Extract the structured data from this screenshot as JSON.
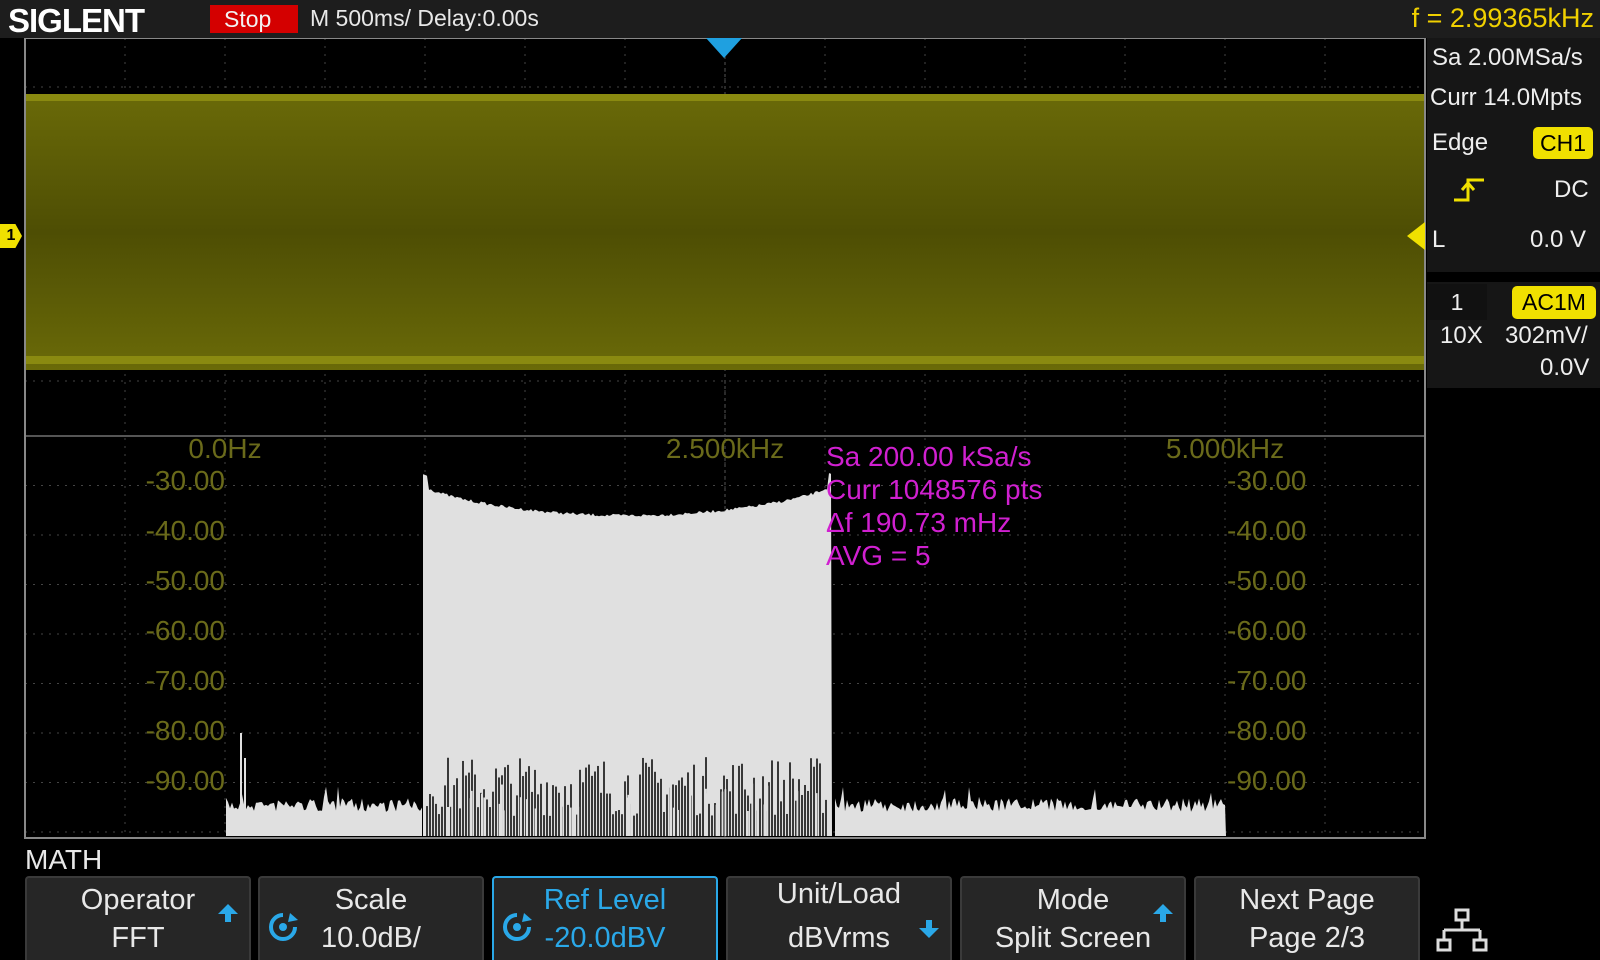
{
  "header": {
    "brand": "SIGLENT",
    "run_state": "Stop",
    "timebase": "M 500ms/  Delay:0.00s",
    "frequency": "f = 2.99365kHz"
  },
  "acquisition": {
    "sample_rate": "Sa 2.00MSa/s",
    "memory_depth": "Curr 14.0Mpts"
  },
  "trigger": {
    "type": "Edge",
    "source": "CH1",
    "coupling": "DC",
    "level_label": "L",
    "level": "0.0 V"
  },
  "channel": {
    "number": "1",
    "coupling": "AC1M",
    "probe": "10X",
    "scale": "302mV/",
    "offset": "0.0V",
    "marker": "1"
  },
  "fft": {
    "freq_labels": [
      "0.0Hz",
      "2.500kHz",
      "5.000kHz"
    ],
    "db_labels": [
      "-30.00",
      "-40.00",
      "-50.00",
      "-60.00",
      "-70.00",
      "-80.00",
      "-90.00"
    ],
    "sample_rate": "Sa 200.00 kSa/s",
    "points": "Curr 1048576 pts",
    "resolution": "Δf 190.73 mHz",
    "average": "AVG = 5"
  },
  "menu_title": "MATH",
  "softkeys": [
    {
      "line1": "Operator",
      "line2": "FFT",
      "arrow": "up"
    },
    {
      "line1": "Scale",
      "line2": "10.0dB/",
      "knob": true
    },
    {
      "line1": "Ref Level",
      "line2": "-20.0dBV",
      "knob": true,
      "active": true
    },
    {
      "line1": "Unit/Load",
      "line2": "dBVrms",
      "arrow": "down"
    },
    {
      "line1": "Mode",
      "line2": "Split Screen",
      "arrow": "up"
    },
    {
      "line1": "Next Page",
      "line2": "Page 2/3"
    }
  ],
  "colors": {
    "ch1": "#f0e000",
    "math": "#d020d0",
    "accent": "#1fa0e0",
    "stop": "#d40000"
  },
  "icons": [
    "network-icon",
    "knob-icon",
    "up-arrow-icon",
    "down-arrow-icon",
    "trigger-rising-edge-icon"
  ]
}
